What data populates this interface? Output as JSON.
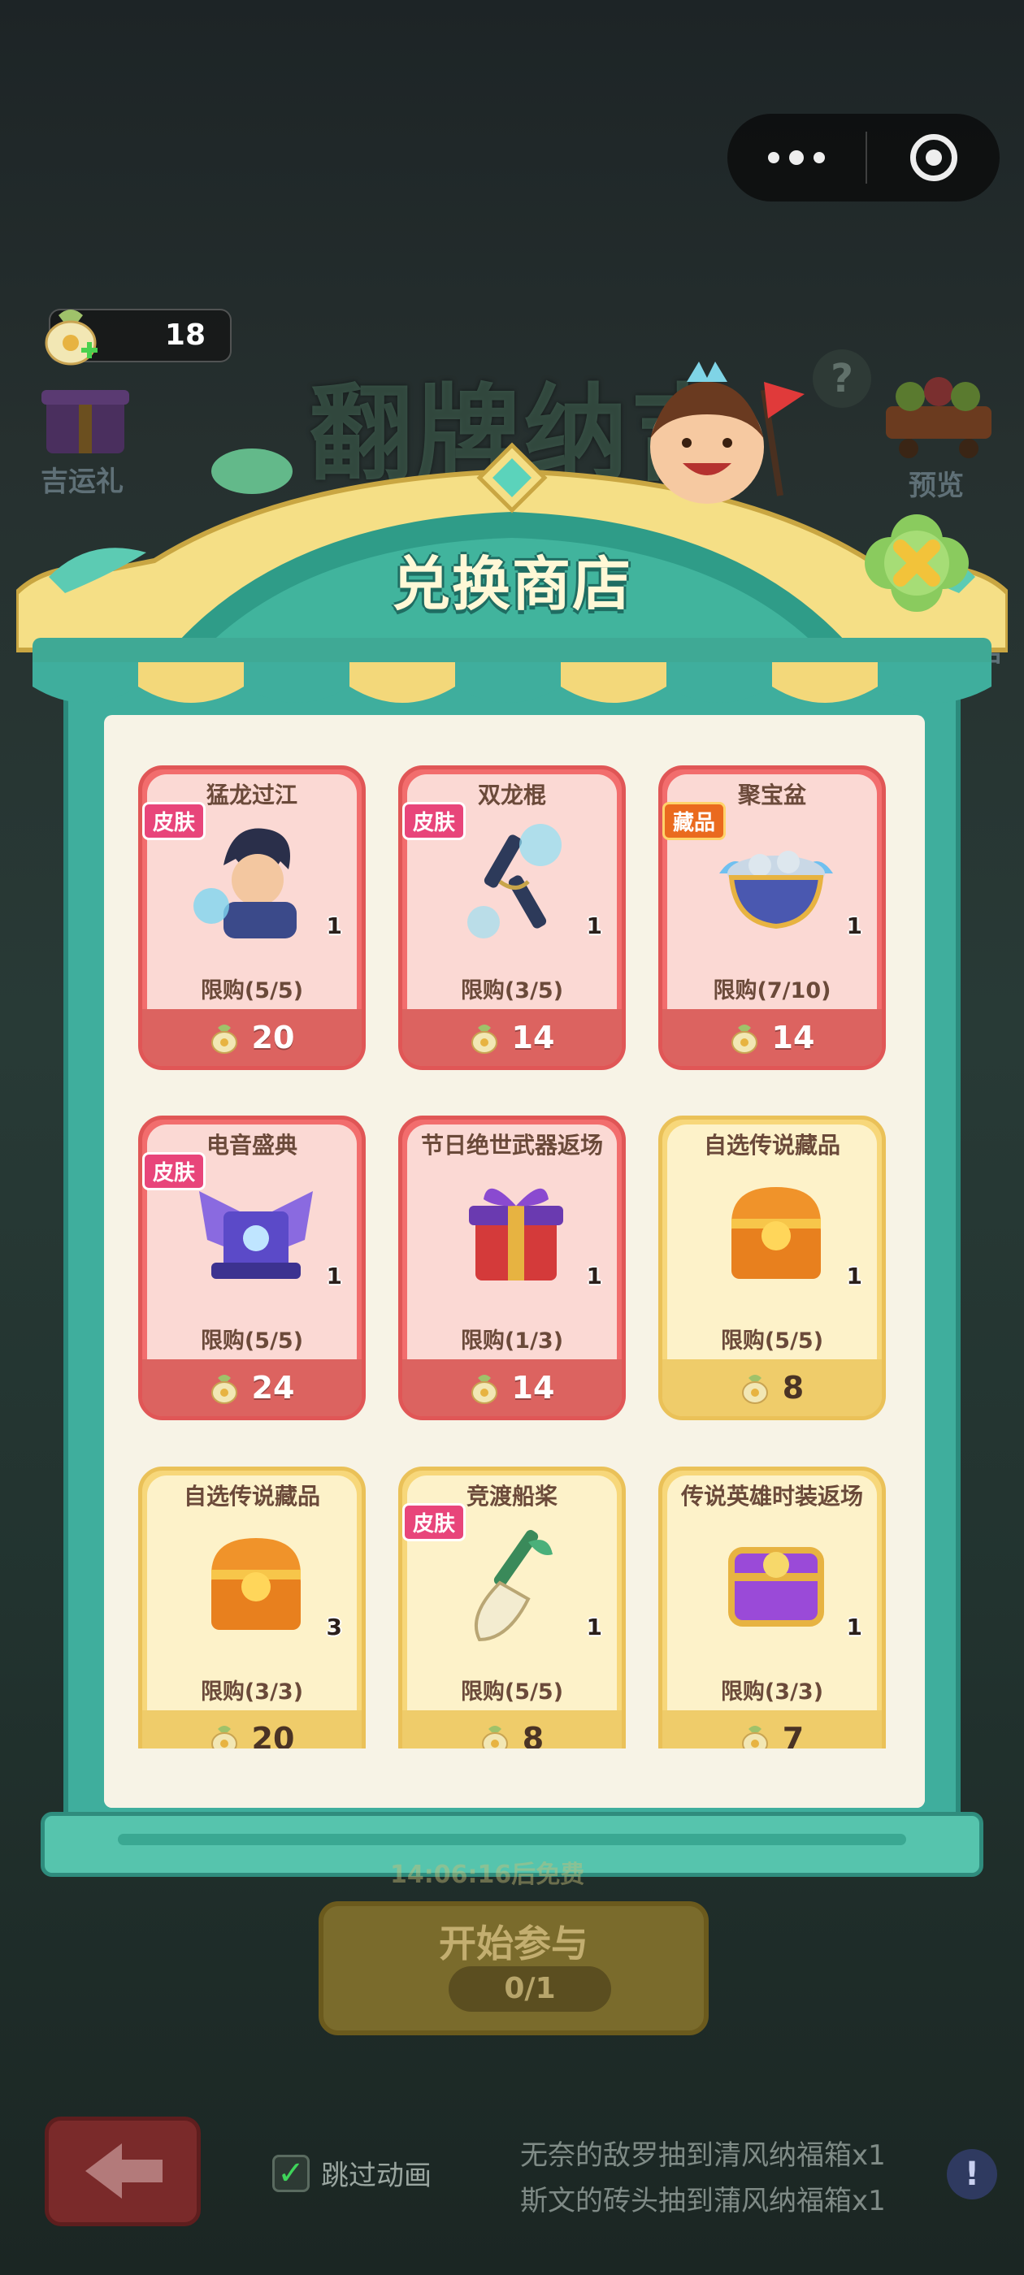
{
  "header": {
    "currency_count": "18",
    "lucky_gift_label": "吉运礼",
    "preview_label": "预览",
    "shop_side_label": "店",
    "event_title": "翻牌纳吉"
  },
  "shop": {
    "title": "兑换商店",
    "items": [
      {
        "name": "猛龙过江",
        "tag": "皮肤",
        "tag_color": "pink",
        "qty": "1",
        "limit": "限购(5/5)",
        "price": "20",
        "style": "red"
      },
      {
        "name": "双龙棍",
        "tag": "皮肤",
        "tag_color": "pink",
        "qty": "1",
        "limit": "限购(3/5)",
        "price": "14",
        "style": "red"
      },
      {
        "name": "聚宝盆",
        "tag": "藏品",
        "tag_color": "orange",
        "qty": "1",
        "limit": "限购(7/10)",
        "price": "14",
        "style": "red"
      },
      {
        "name": "电音盛典",
        "tag": "皮肤",
        "tag_color": "pink",
        "qty": "1",
        "limit": "限购(5/5)",
        "price": "24",
        "style": "red"
      },
      {
        "name": "节日绝世武器返场",
        "tag": "",
        "tag_color": "",
        "qty": "1",
        "limit": "限购(1/3)",
        "price": "14",
        "style": "red"
      },
      {
        "name": "自选传说藏品",
        "tag": "",
        "tag_color": "",
        "qty": "1",
        "limit": "限购(5/5)",
        "price": "8",
        "style": "gold"
      },
      {
        "name": "自选传说藏品",
        "tag": "",
        "tag_color": "",
        "qty": "3",
        "limit": "限购(3/3)",
        "price": "20",
        "style": "gold"
      },
      {
        "name": "竞渡船桨",
        "tag": "皮肤",
        "tag_color": "pink",
        "qty": "1",
        "limit": "限购(5/5)",
        "price": "8",
        "style": "gold"
      },
      {
        "name": "传说英雄时装返场",
        "tag": "",
        "tag_color": "",
        "qty": "1",
        "limit": "限购(3/3)",
        "price": "7",
        "style": "gold"
      }
    ]
  },
  "footer": {
    "timer": "14:06:16后免费",
    "start_label": "开始参与",
    "start_count": "0/1",
    "skip_label": "跳过动画",
    "ticker_line1": "无奈的敌罗抽到清风纳福箱x1",
    "ticker_line2": "斯文的砖头抽到蒲风纳福箱x1",
    "info_icon_glyph": "!"
  }
}
